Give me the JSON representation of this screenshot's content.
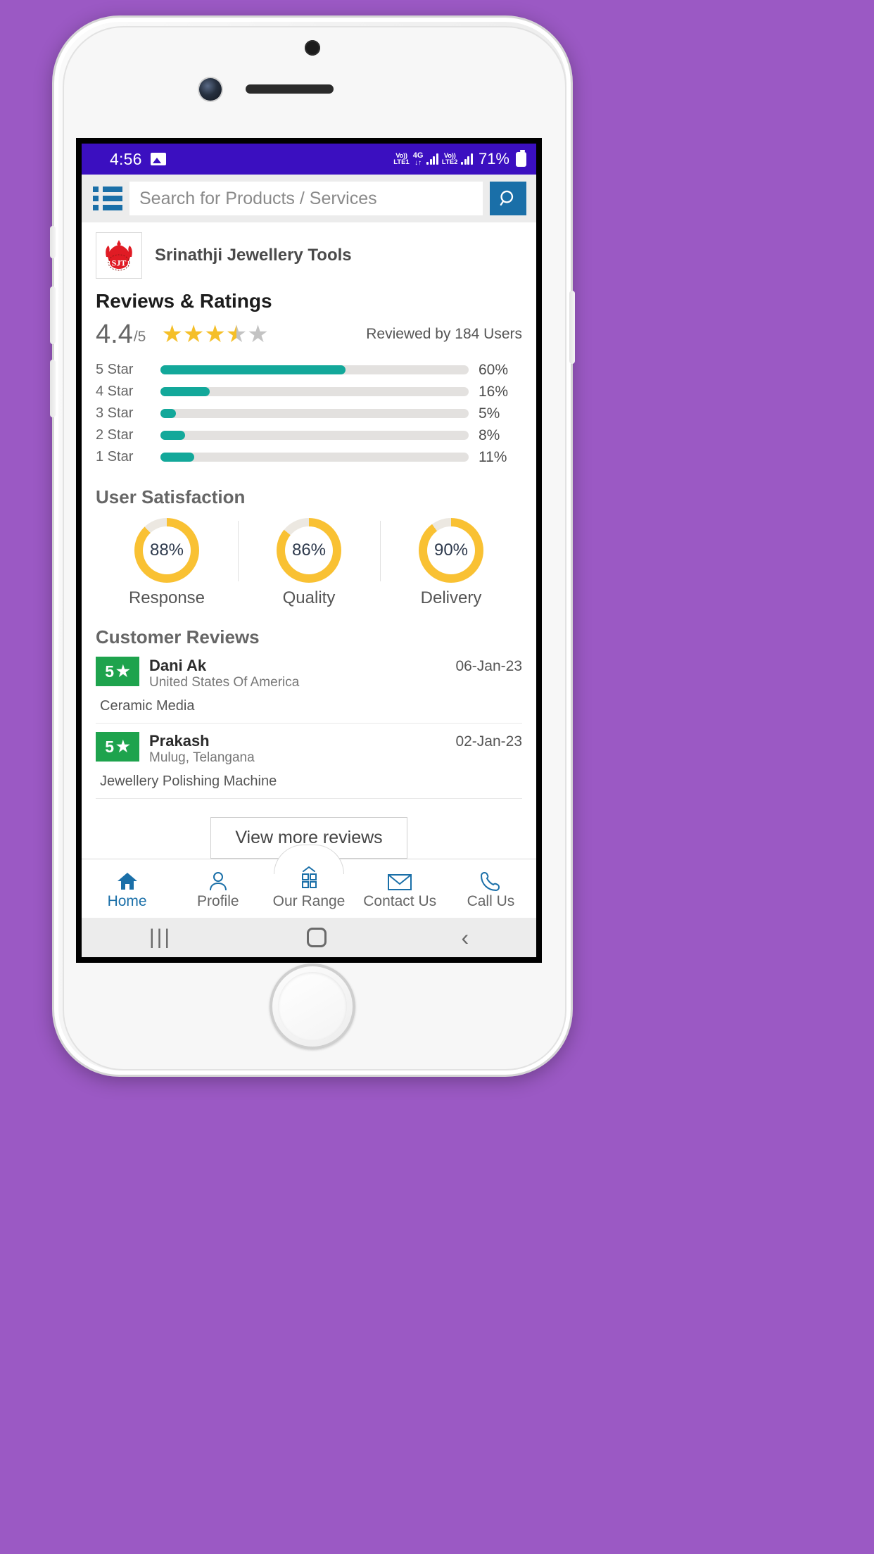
{
  "status_bar": {
    "time": "4:56",
    "image_icon": "image-icon",
    "volte1": "Vo)) LTE1",
    "volte1_top": "Vo))",
    "volte1_bottom": "LTE1",
    "network": "4G",
    "network_arrows": "↓↑",
    "volte2_top": "Vo))",
    "volte2_bottom": "LTE2",
    "battery_percent": "71%"
  },
  "search": {
    "menu_icon": "list-menu-icon",
    "placeholder": "Search for Products / Services",
    "value": "",
    "search_icon": "search-icon"
  },
  "company": {
    "logo_alt": "SJT",
    "name": "Srinathji Jewellery Tools"
  },
  "ratings": {
    "title": "Reviews & Ratings",
    "score": "4.4",
    "score_max": "/5",
    "stars_filled": 3.5,
    "reviewed_by": "Reviewed by 184 Users",
    "bar_color": "#13a89a",
    "track_color": "#e3e1df"
  },
  "chart_data": {
    "type": "bar",
    "title": "Reviews & Ratings distribution",
    "categories": [
      "5 Star",
      "4 Star",
      "3 Star",
      "2 Star",
      "1 Star"
    ],
    "values": [
      60,
      16,
      5,
      8,
      11
    ],
    "value_labels": [
      "60%",
      "16%",
      "5%",
      "8%",
      "11%"
    ],
    "xlabel": "",
    "ylabel": "",
    "xlim": [
      0,
      100
    ],
    "grid": false,
    "legend": "none",
    "orientation": "horizontal",
    "series_color": "#13a89a"
  },
  "satisfaction": {
    "title": "User Satisfaction",
    "donut_color": "#f9c133",
    "donut_track": "#ece8e1",
    "items": [
      {
        "value": 88,
        "value_label": "88%",
        "label": "Response"
      },
      {
        "value": 86,
        "value_label": "86%",
        "label": "Quality"
      },
      {
        "value": 90,
        "value_label": "90%",
        "label": "Delivery"
      }
    ]
  },
  "customer_reviews": {
    "title": "Customer Reviews",
    "badge_color": "#1ea34d",
    "items": [
      {
        "rating": "5",
        "name": "Dani Ak",
        "location": "United States Of America",
        "date": "06-Jan-23",
        "product": "Ceramic Media"
      },
      {
        "rating": "5",
        "name": "Prakash",
        "location": "Mulug, Telangana",
        "date": "02-Jan-23",
        "product": "Jewellery Polishing Machine"
      }
    ],
    "view_more_label": "View more reviews"
  },
  "bottom_nav": {
    "items": [
      {
        "label": "Home",
        "icon": "home-icon",
        "active": true
      },
      {
        "label": "Profile",
        "icon": "person-icon",
        "active": false
      },
      {
        "label": "Our Range",
        "icon": "grid-icon",
        "active": false
      },
      {
        "label": "Contact Us",
        "icon": "envelope-icon",
        "active": false
      },
      {
        "label": "Call Us",
        "icon": "phone-icon",
        "active": false
      }
    ]
  },
  "system_bar": {
    "recents": "|||",
    "home": "home-square-icon",
    "back": "‹"
  }
}
